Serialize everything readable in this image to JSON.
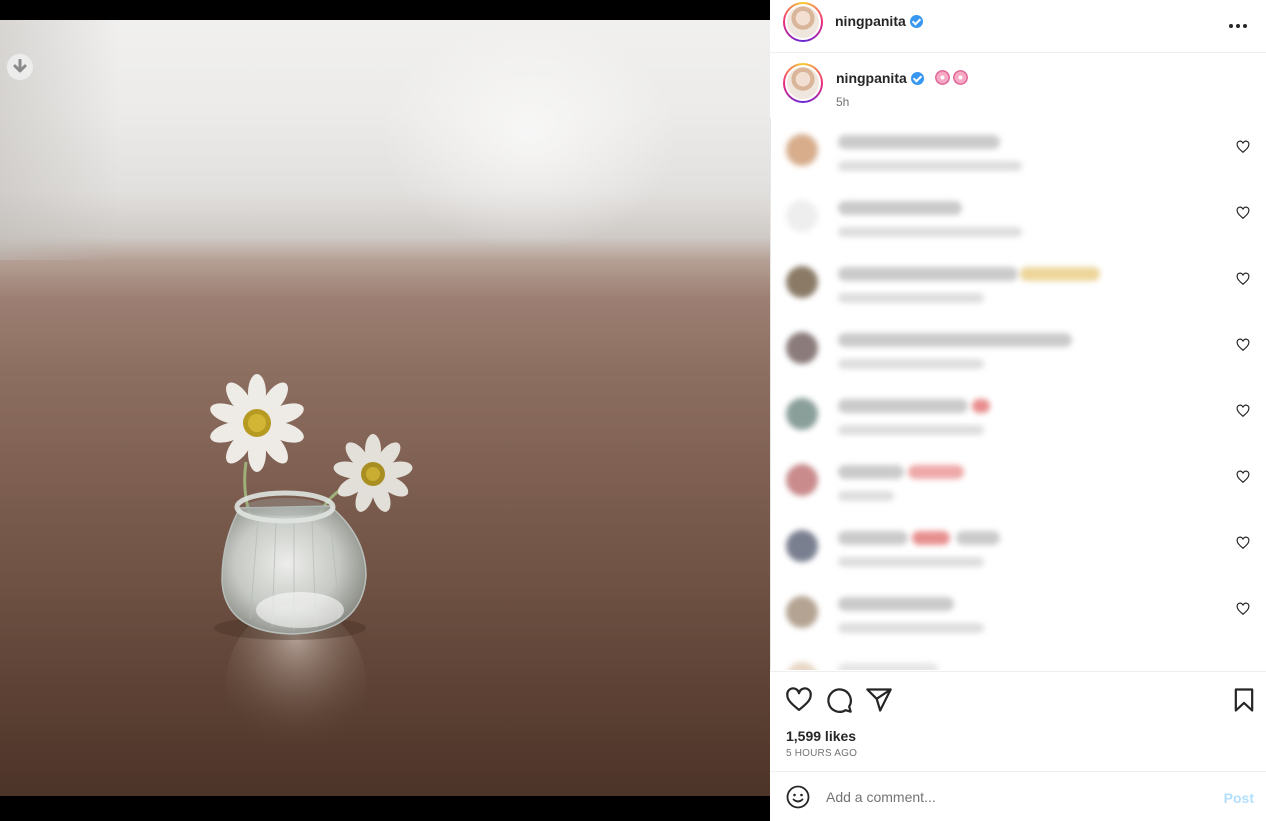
{
  "post": {
    "username": "ningpanita",
    "verified": true
  },
  "caption": {
    "username": "ningpanita",
    "emojis": [
      "cherry-blossom-emoji",
      "cherry-blossom-emoji"
    ],
    "time": "5h"
  },
  "comments": {
    "count_visible": 8,
    "blurred": true,
    "avatar_colors": [
      "#d7ad8c",
      "#f2f2f2",
      "#8a7a66",
      "#8b7b7b",
      "#8a9f9a",
      "#c98b8b",
      "#7a7f90",
      "#b4a392"
    ],
    "highlight_colors": [
      "",
      "",
      "#e7c779",
      "",
      "#e06666",
      "#e88a8a",
      "#e06a6a",
      ""
    ]
  },
  "actions": {
    "likes": "1,599 likes",
    "date": "5 HOURS AGO"
  },
  "comment_box": {
    "placeholder": "Add a comment...",
    "post_label": "Post"
  },
  "colors": {
    "verified": "#3897f0",
    "post_button": "#b2dffc",
    "muted_text": "#737373"
  }
}
